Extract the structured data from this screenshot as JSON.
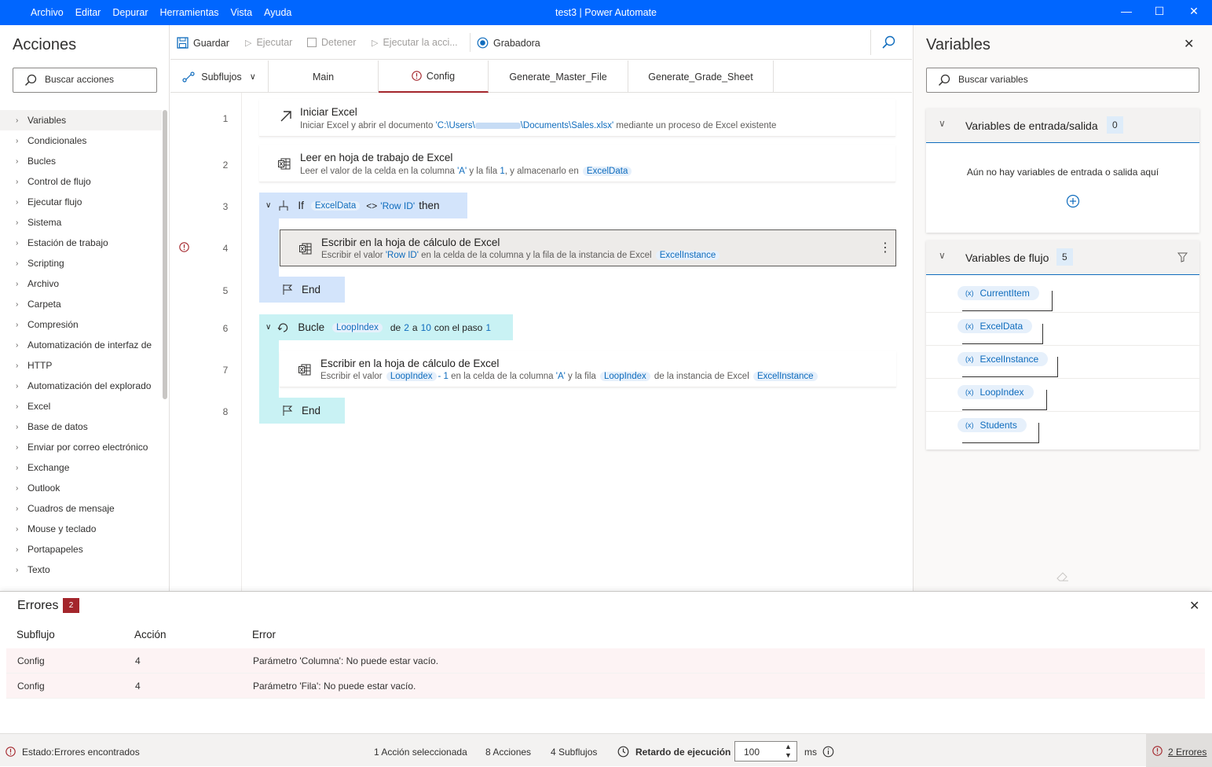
{
  "window": {
    "title": "test3 | Power Automate",
    "menu": [
      "Archivo",
      "Editar",
      "Depurar",
      "Herramientas",
      "Vista",
      "Ayuda"
    ]
  },
  "actions_pane": {
    "title": "Acciones",
    "search_placeholder": "Buscar acciones",
    "categories": [
      "Variables",
      "Condicionales",
      "Bucles",
      "Control de flujo",
      "Ejecutar flujo",
      "Sistema",
      "Estación de trabajo",
      "Scripting",
      "Archivo",
      "Carpeta",
      "Compresión",
      "Automatización de interfaz de",
      "HTTP",
      "Automatización del explorado",
      "Excel",
      "Base de datos",
      "Enviar por correo electrónico",
      "Exchange",
      "Outlook",
      "Cuadros de mensaje",
      "Mouse y teclado",
      "Portapapeles",
      "Texto"
    ]
  },
  "toolbar": {
    "save": "Guardar",
    "run": "Ejecutar",
    "stop": "Detener",
    "run_action": "Ejecutar la acci...",
    "recorder": "Grabadora"
  },
  "tabs": {
    "subflows": "Subflujos",
    "items": [
      "Main",
      "Config",
      "Generate_Master_File",
      "Generate_Grade_Sheet"
    ]
  },
  "flow": {
    "line_numbers": [
      "1",
      "2",
      "3",
      "4",
      "5",
      "6",
      "7",
      "8"
    ],
    "step1": {
      "title": "Iniciar Excel",
      "desc_a": "Iniciar Excel y abrir el documento ",
      "desc_path_a": "'C:\\Users\\",
      "desc_path_b": "\\Documents\\Sales.xlsx'",
      "desc_b": " mediante un proceso de Excel existente"
    },
    "step2": {
      "title": "Leer en hoja de trabajo de Excel",
      "desc_a": "Leer el valor de la celda en la columna ",
      "col": "'A'",
      "desc_b": " y la fila ",
      "row": "1",
      "desc_c": ", y almacenarlo en ",
      "var": "ExcelData"
    },
    "step3": {
      "kw": "If",
      "var": "ExcelData",
      "op": "<>",
      "val": "'Row ID'",
      "then": "then"
    },
    "step4": {
      "title": "Escribir en la hoja de cálculo de Excel",
      "desc_a": "Escribir el valor ",
      "val": "'Row ID'",
      "desc_b": " en la celda de la columna  y la fila  de la instancia de Excel ",
      "var": "ExcelInstance"
    },
    "step5": {
      "kw": "End"
    },
    "step6": {
      "kw": "Bucle",
      "var": "LoopIndex",
      "a": "de",
      "from": "2",
      "b": "a",
      "to": "10",
      "c": "con el paso",
      "step": "1"
    },
    "step7": {
      "title": "Escribir en la hoja de cálculo de Excel",
      "desc_a": "Escribir el valor ",
      "var1": "LoopIndex",
      "minus": "- 1",
      "desc_b": " en la celda de la columna ",
      "col": "'A'",
      "desc_c": " y la fila ",
      "var2": "LoopIndex",
      "desc_d": " de la instancia de Excel ",
      "var3": "ExcelInstance"
    },
    "step8": {
      "kw": "End"
    }
  },
  "variables_pane": {
    "title": "Variables",
    "search_placeholder": "Buscar variables",
    "io_section": {
      "title": "Variables de entrada/salida",
      "count": "0",
      "empty_text": "Aún no hay variables de entrada o salida aquí"
    },
    "flow_section": {
      "title": "Variables de flujo",
      "count": "5",
      "items": [
        "CurrentItem",
        "ExcelData",
        "ExcelInstance",
        "LoopIndex",
        "Students"
      ]
    }
  },
  "errors_panel": {
    "title": "Errores",
    "count": "2",
    "columns": [
      "Subflujo",
      "Acción",
      "Error"
    ],
    "rows": [
      {
        "subflow": "Config",
        "action": "4",
        "error": "Parámetro 'Columna': No puede estar vacío."
      },
      {
        "subflow": "Config",
        "action": "4",
        "error": "Parámetro 'Fila': No puede estar vacío."
      }
    ]
  },
  "status_bar": {
    "status_label": "Estado:",
    "status_value": "Errores encontrados",
    "selected": "1 Acción seleccionada",
    "actions": "8 Acciones",
    "subflows": "4 Subflujos",
    "delay_label": "Retardo de ejecución",
    "delay_value": "100",
    "delay_unit": "ms",
    "errors_link": "2 Errores"
  },
  "colors": {
    "titlebar": "#0066ff",
    "accent": "#0f6cbd",
    "error": "#a4262c",
    "if_block": "#d3e4fb",
    "loop_block": "#c9f2f4"
  }
}
